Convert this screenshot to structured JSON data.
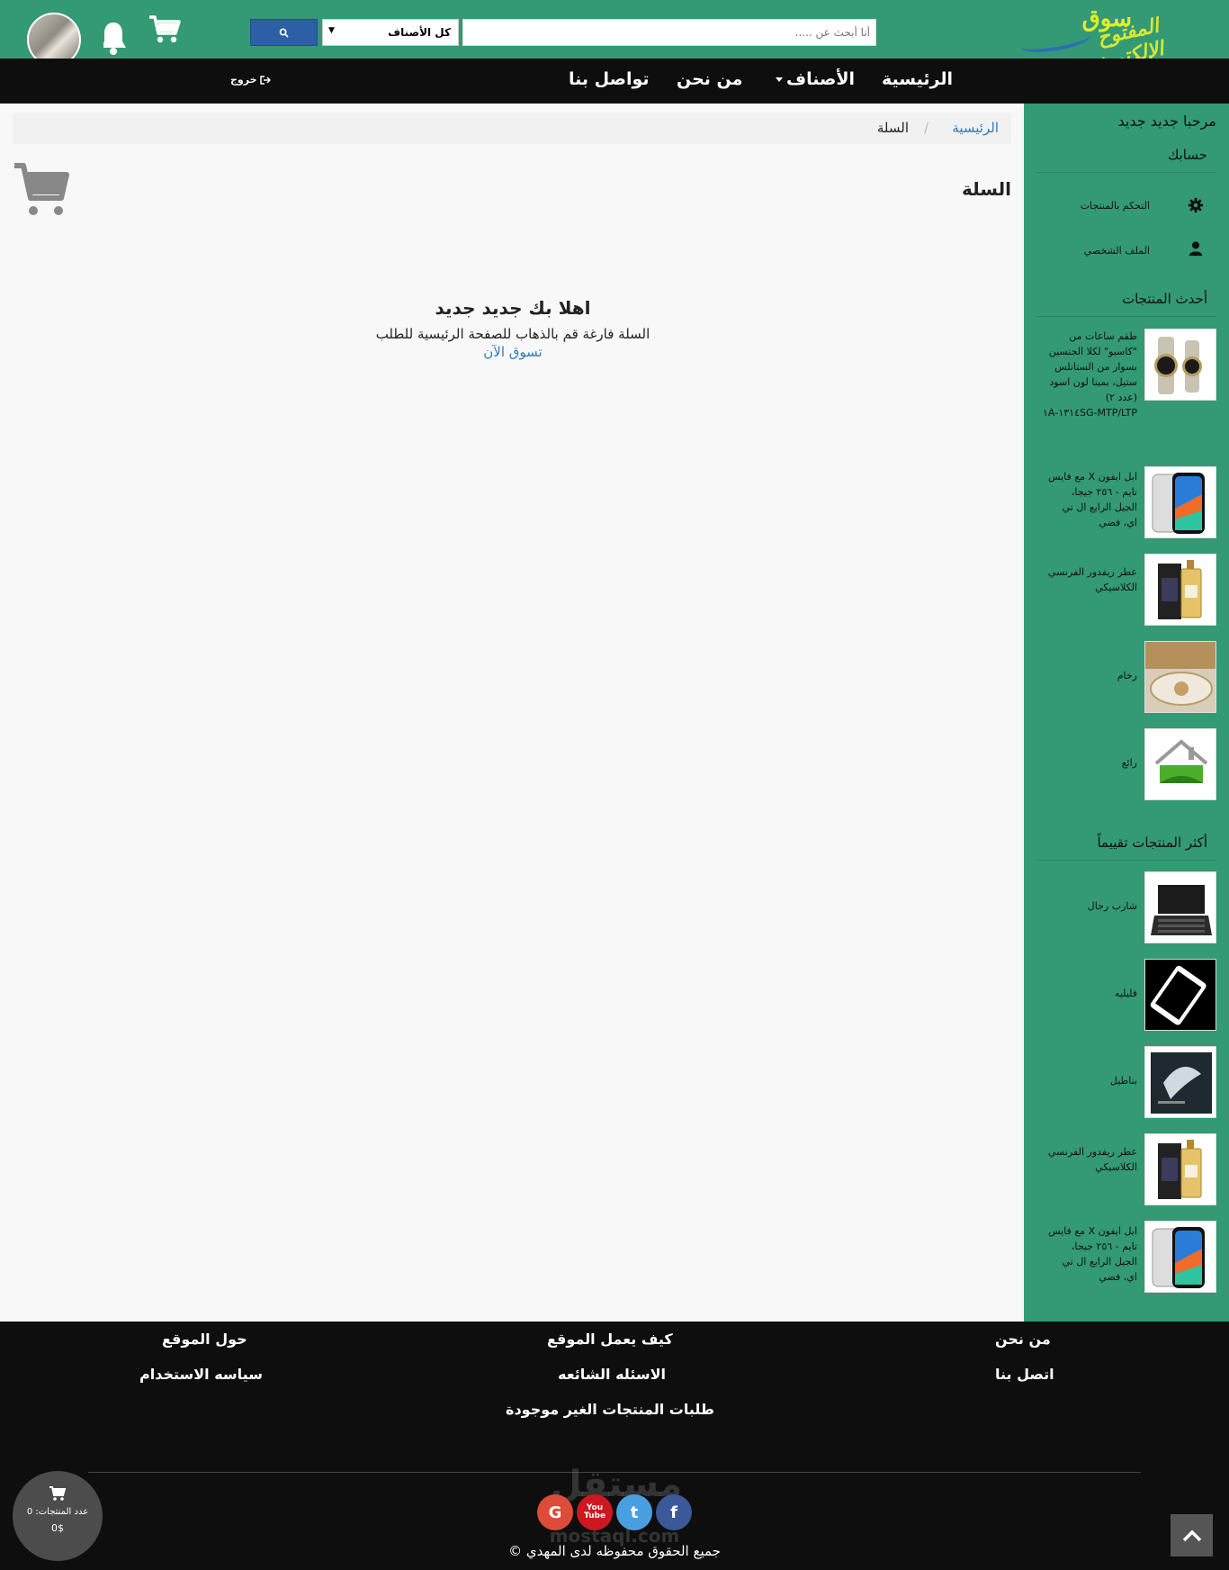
{
  "header": {
    "logo_line1": "سوق",
    "logo_line2": "المفتوح الإلكتروني",
    "search_placeholder": "أنا أبحث عن .....",
    "category_selected": "كل الأصناف"
  },
  "nav": {
    "home": "الرئيسية",
    "categories": "الأصناف",
    "about": "من نحن",
    "contact": "تواصل بنا",
    "logout": "خروج"
  },
  "breadcrumb": {
    "home": "الرئيسية",
    "separator": "/",
    "current": "السلة"
  },
  "main": {
    "title": "السلة",
    "greeting": "اهلا بك جديد جديد",
    "empty_message": "السلة فارغة قم بالذهاب للصفحة الرئيسية للطلب",
    "shop_now": "تسوق الآن"
  },
  "sidebar": {
    "welcome": "مرحبا جديد جديد",
    "account": "حسابك",
    "links": [
      {
        "label": "التحكم بالمنتجات",
        "icon": "gear-icon"
      },
      {
        "label": "الملف الشخصي",
        "icon": "user-icon"
      }
    ],
    "latest_heading": "أحدث المنتجات",
    "latest": [
      {
        "name": "طقم ساعات من \"كاسيو\" لكلا الجنسين بسوار من الستانلس ستيل، بمينا لون اسود (عدد ٢) MTP/LTP-١٣١٤SG-١A"
      },
      {
        "name": "ابل ايفون X مع فايس تايم - ٢٥٦ جيجا، الجيل الرابع ال تي اي، فضي"
      },
      {
        "name": "عطر ريفدور الفرنسي الكلاسيكي"
      },
      {
        "name": "رخام"
      },
      {
        "name": "رائع"
      }
    ],
    "top_rated_heading": "أكثر المنتجات تقييماً",
    "top_rated": [
      {
        "name": "شارب رجال"
      },
      {
        "name": "فليليه"
      },
      {
        "name": "بناطيل"
      },
      {
        "name": "عطر ريفدور الفرنسي الكلاسيكي"
      },
      {
        "name": "ابل ايفون X مع فايس تايم - ٢٥٦ جيجا، الجيل الرابع ال تي اي، فضي"
      }
    ]
  },
  "footer": {
    "about_us": "من نحن",
    "how_it_works": "كيف يعمل الموقع",
    "about_site": "حول الموقع",
    "contact_us": "اتصل بنا",
    "faq": "الاسئله الشائعه",
    "terms": "سياسه الاستخدام",
    "missing_requests": "طلبات المنتجات الغير موجودة",
    "copyright": "جميع الحقوق محفوظه لدى المهدي ©",
    "social": {
      "google": "G",
      "youtube": "You Tube",
      "twitter": "t",
      "facebook": "f"
    },
    "watermark_ar": "مستقل",
    "watermark_en": "mostaql.com"
  },
  "float_cart": {
    "count_label": "عدد المنتجات: 0",
    "total": "0$"
  },
  "colors": {
    "brand_green": "#339a75",
    "nav_black": "#0e0e0e",
    "search_blue": "#2d5fa6",
    "link_blue": "#337ab7"
  }
}
